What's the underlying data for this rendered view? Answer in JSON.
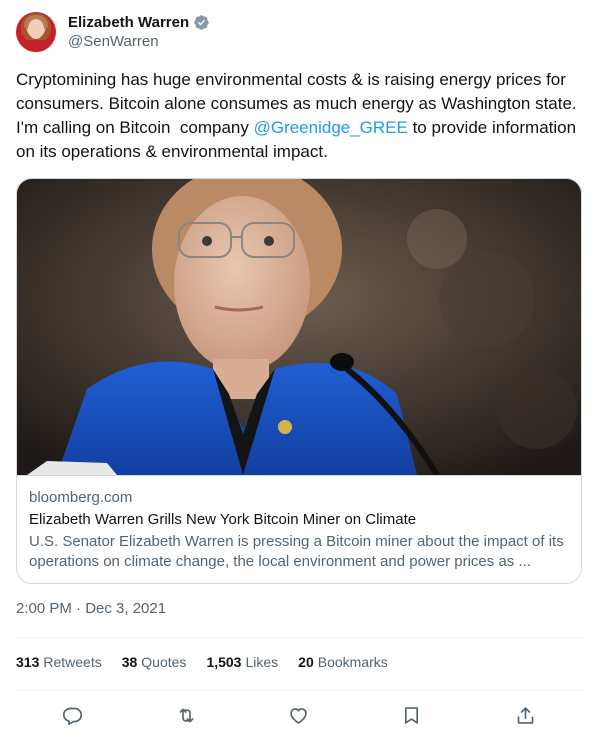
{
  "author": {
    "display_name": "Elizabeth Warren",
    "handle": "@SenWarren",
    "verified_icon": "verified-badge-icon",
    "verified_color": "#829aab"
  },
  "tweet": {
    "text_before": "Cryptomining has huge environmental costs & is raising energy prices for consumers. Bitcoin alone consumes as much energy as Washington state. I'm calling on Bitcoin  company ",
    "mention": "@Greenidge_GREE",
    "text_after": " to provide information on its operations & environmental impact.",
    "mention_color": "#1d9bf0"
  },
  "card": {
    "domain": "bloomberg.com",
    "title": "Elizabeth Warren Grills New York Bitcoin Miner on Climate",
    "description": "U.S. Senator Elizabeth Warren is pressing a Bitcoin miner about the impact of its operations on climate change, the local environment and power prices as ..."
  },
  "timestamp": "2:00 PM · Dec 3, 2021",
  "stats": {
    "retweets_count": "313",
    "retweets_label": "Retweets",
    "quotes_count": "38",
    "quotes_label": "Quotes",
    "likes_count": "1,503",
    "likes_label": "Likes",
    "bookmarks_count": "20",
    "bookmarks_label": "Bookmarks"
  },
  "actions": [
    "reply-icon",
    "retweet-icon",
    "like-icon",
    "bookmark-icon",
    "share-icon"
  ],
  "colors": {
    "text_primary": "#0f1419",
    "text_secondary": "#536471",
    "border": "#cfd9de",
    "divider": "#eff3f4"
  }
}
